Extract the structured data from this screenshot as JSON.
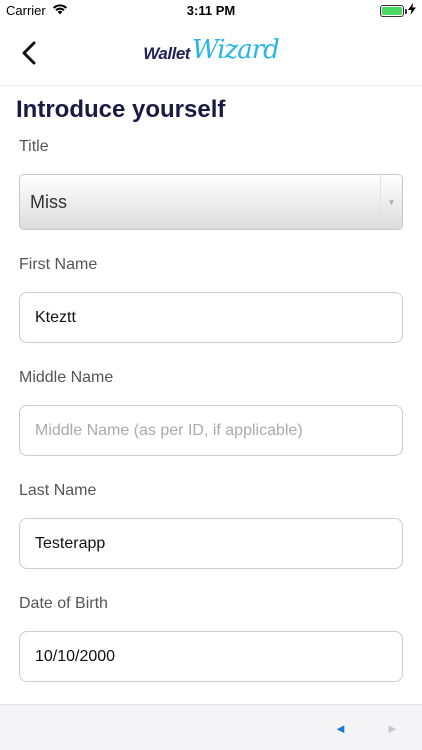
{
  "status_bar": {
    "carrier": "Carrier",
    "time": "3:11 PM",
    "battery_level": 1.0,
    "battery_color": "#4cd964"
  },
  "nav": {
    "back_icon": "chevron-left-icon",
    "logo_word1": "Wallet",
    "logo_word2": "Wizard"
  },
  "page": {
    "title": "Introduce yourself"
  },
  "form": {
    "title_label": "Title",
    "title_value": "Miss",
    "first_name_label": "First Name",
    "first_name_value": "Kteztt",
    "middle_name_label": "Middle Name",
    "middle_name_placeholder": "Middle Name (as per ID, if applicable)",
    "last_name_label": "Last Name",
    "last_name_value": "Testerapp",
    "dob_label": "Date of Birth",
    "dob_value": "10/10/2000"
  },
  "toolbar": {
    "prev_symbol": "◄",
    "next_symbol": "►",
    "prev_color": "#1f78d1",
    "next_color": "#c9c9cc"
  }
}
